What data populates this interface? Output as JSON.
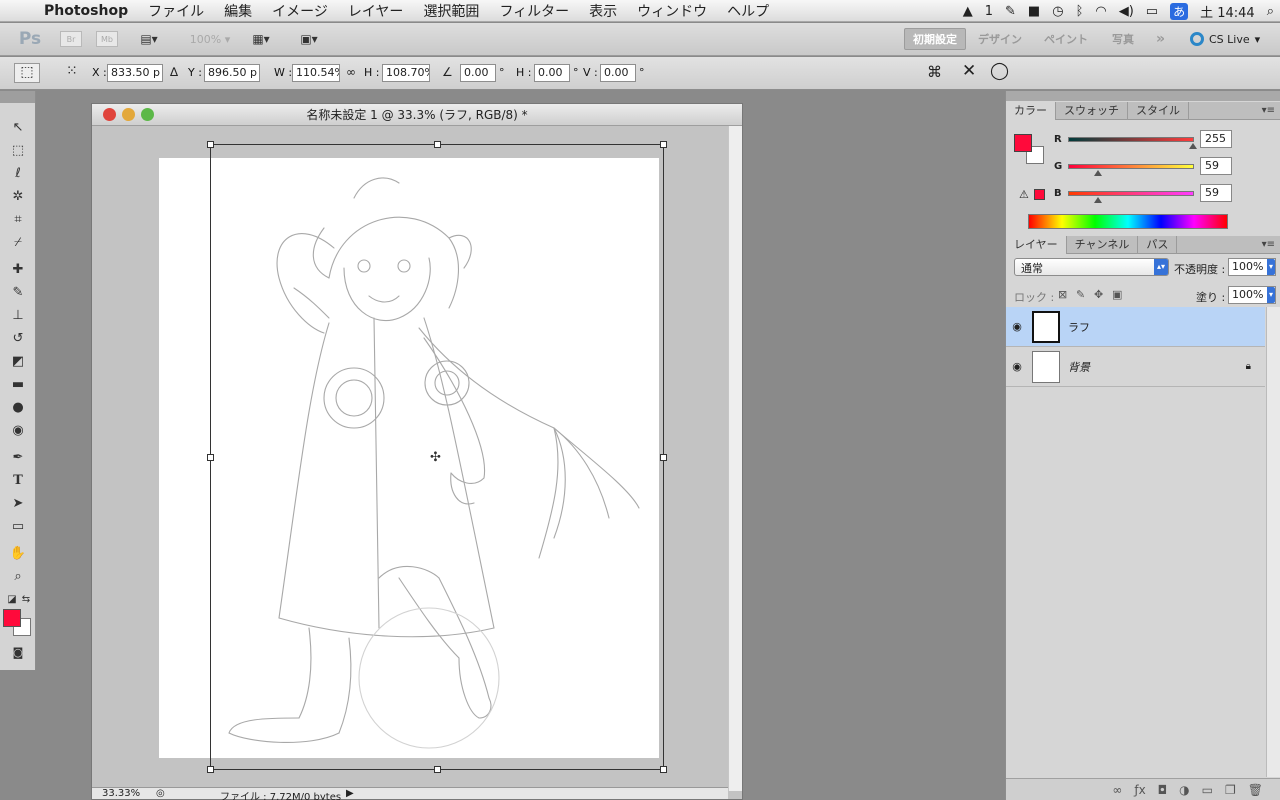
{
  "menubar": {
    "app_name": "Photoshop",
    "items": [
      "ファイル",
      "編集",
      "イメージ",
      "レイヤー",
      "選択範囲",
      "フィルター",
      "表示",
      "ウィンドウ",
      "ヘルプ"
    ],
    "status": {
      "adobe_count": "1",
      "input_method": "あ",
      "clock": "土 14:44"
    }
  },
  "appbar": {
    "logo": "Ps",
    "bridge": "Br",
    "minibridge": "Mb",
    "zoom": "100%",
    "workspaces": [
      "初期設定",
      "デザイン",
      "ペイント",
      "写真"
    ],
    "more": "»",
    "cs_live": "CS Live"
  },
  "options": {
    "x_label": "X :",
    "x_value": "833.50 p",
    "y_label": "Y :",
    "y_value": "896.50 p",
    "w_label": "W :",
    "w_value": "110.54%",
    "h_label": "H :",
    "h_value": "108.70%",
    "angle_value": "0.00",
    "deg": "°",
    "hskew_label": "H :",
    "hskew_value": "0.00",
    "vskew_label": "V :",
    "vskew_value": "0.00"
  },
  "document": {
    "title": "名称未設定 1 @ 33.3% (ラフ, RGB/8) *",
    "zoom": "33.33%",
    "file_info": "ファイル : 7.72M/0 bytes"
  },
  "color_panel": {
    "tabs": [
      "カラー",
      "スウォッチ",
      "スタイル"
    ],
    "channels": [
      {
        "label": "R",
        "value": "255",
        "fraction": 1.0
      },
      {
        "label": "G",
        "value": "59",
        "fraction": 0.23
      },
      {
        "label": "B",
        "value": "59",
        "fraction": 0.23
      }
    ],
    "foreground": "#ff0a3b",
    "background": "#ffffff"
  },
  "layers_panel": {
    "tabs": [
      "レイヤー",
      "チャンネル",
      "パス"
    ],
    "blend_mode": "通常",
    "opacity_label": "不透明度 :",
    "opacity_value": "100%",
    "lock_label": "ロック :",
    "fill_label": "塗り :",
    "fill_value": "100%",
    "layers": [
      {
        "name": "ラフ",
        "selected": true
      },
      {
        "name": "背景",
        "selected": false,
        "locked": true
      }
    ]
  }
}
